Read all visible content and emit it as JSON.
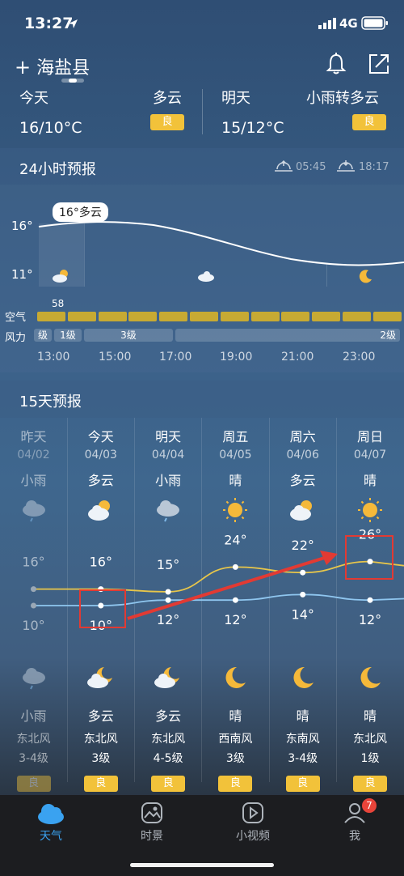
{
  "status": {
    "time": "13:27",
    "network": "4G"
  },
  "header": {
    "city": "海盐县",
    "add_icon": "plus-icon",
    "bell_icon": "bell-icon",
    "share_icon": "share-icon"
  },
  "summary": {
    "today": {
      "label": "今天",
      "temp": "16/10°C",
      "condition": "多云",
      "aqi": "良"
    },
    "tomorrow": {
      "label": "明天",
      "temp": "15/12°C",
      "condition": "小雨转多云",
      "aqi": "良"
    }
  },
  "hourly": {
    "title": "24小时预报",
    "sunrise": "05:45",
    "sunset": "18:17",
    "y_labels": [
      "16°",
      "11°"
    ],
    "tooltip": "16°多云",
    "aq_label": "空气",
    "aq_value": "58",
    "wind_label": "风力",
    "wind_segments": [
      "级",
      "1级",
      "3级",
      "2级"
    ],
    "times": [
      "13:00",
      "15:00",
      "17:00",
      "19:00",
      "21:00",
      "23:00"
    ],
    "icons": [
      "partly-sunny-icon",
      "cloud-icon",
      "moon-icon"
    ]
  },
  "daily": {
    "title": "15天预报",
    "days": [
      {
        "name": "昨天",
        "date": "04/02",
        "day_cond": "小雨",
        "high": "16°",
        "low": "10°",
        "night_cond": "小雨",
        "wind_dir": "东北风",
        "wind_lv": "3-4级",
        "aqi": "良",
        "day_icon": "rain-cloud-icon",
        "night_icon": "rain-cloud-icon"
      },
      {
        "name": "今天",
        "date": "04/03",
        "day_cond": "多云",
        "high": "16°",
        "low": "10°",
        "night_cond": "多云",
        "wind_dir": "东北风",
        "wind_lv": "3级",
        "aqi": "良",
        "day_icon": "partly-sunny-icon",
        "night_icon": "moon-cloud-icon"
      },
      {
        "name": "明天",
        "date": "04/04",
        "day_cond": "小雨",
        "high": "15°",
        "low": "12°",
        "night_cond": "多云",
        "wind_dir": "东北风",
        "wind_lv": "4-5级",
        "aqi": "良",
        "day_icon": "rain-cloud-icon",
        "night_icon": "moon-cloud-icon"
      },
      {
        "name": "周五",
        "date": "04/05",
        "day_cond": "晴",
        "high": "24°",
        "low": "12°",
        "night_cond": "晴",
        "wind_dir": "西南风",
        "wind_lv": "3级",
        "aqi": "良",
        "day_icon": "sun-icon",
        "night_icon": "moon-icon"
      },
      {
        "name": "周六",
        "date": "04/06",
        "day_cond": "多云",
        "high": "22°",
        "low": "14°",
        "night_cond": "晴",
        "wind_dir": "东南风",
        "wind_lv": "3-4级",
        "aqi": "良",
        "day_icon": "partly-sunny-icon",
        "night_icon": "moon-icon"
      },
      {
        "name": "周日",
        "date": "04/07",
        "day_cond": "晴",
        "high": "26°",
        "low": "12°",
        "night_cond": "晴",
        "wind_dir": "东北风",
        "wind_lv": "1级",
        "aqi": "良",
        "day_icon": "sun-icon",
        "night_icon": "moon-icon"
      }
    ]
  },
  "tabs": [
    {
      "label": "天气",
      "icon": "cloud-tab-icon"
    },
    {
      "label": "时景",
      "icon": "photo-tab-icon"
    },
    {
      "label": "小视频",
      "icon": "play-tab-icon"
    },
    {
      "label": "我",
      "icon": "person-tab-icon",
      "badge": "7"
    }
  ],
  "colors": {
    "accent": "#3aa2f0",
    "aqi": "#f2c23a",
    "annotation": "#e23a33",
    "high_line": "#e8c64a",
    "low_line": "#8fc6ef"
  }
}
